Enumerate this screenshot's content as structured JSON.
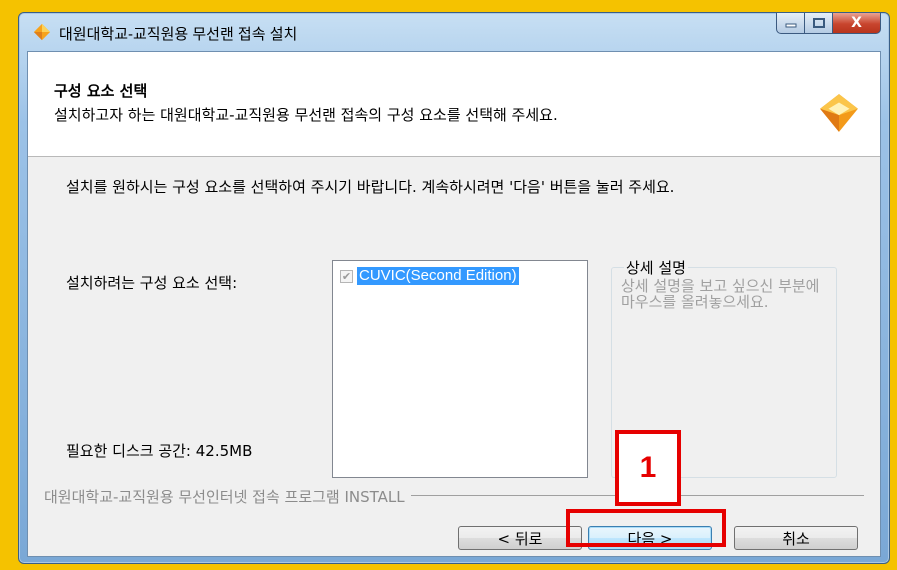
{
  "window": {
    "title": "대원대학교-교직원용 무선랜 접속 설치",
    "controls": {
      "close_label": "X"
    }
  },
  "header": {
    "title": "구성 요소 선택",
    "subtitle": "설치하고자 하는 대원대학교-교직원용 무선랜 접속의 구성 요소를 선택해 주세요."
  },
  "body": {
    "instruction": "설치를 원하시는 구성 요소를 선택하여 주시기 바랍니다. 계속하시려면 '다음' 버튼을 눌러 주세요.",
    "components_label": "설치하려는 구성 요소 선택:",
    "disk_space_label": "필요한 디스크 공간: 42.5MB",
    "components": [
      {
        "name": "CUVIC(Second Edition)",
        "checked": true
      }
    ],
    "description": {
      "legend": "상세 설명",
      "text": "상세 설명을 보고 싶으신 부분에 마우스를 올려놓으세요."
    }
  },
  "footer": {
    "brand": "대원대학교-교직원용 무선인터넷 접속 프로그램 INSTALL",
    "back_label": "< 뒤로",
    "next_label": "다음 >",
    "cancel_label": "취소"
  },
  "annotation": {
    "step_number": "1",
    "color": "#e60000"
  },
  "colors": {
    "selection": "#3399ff",
    "background": "#f5c200"
  }
}
